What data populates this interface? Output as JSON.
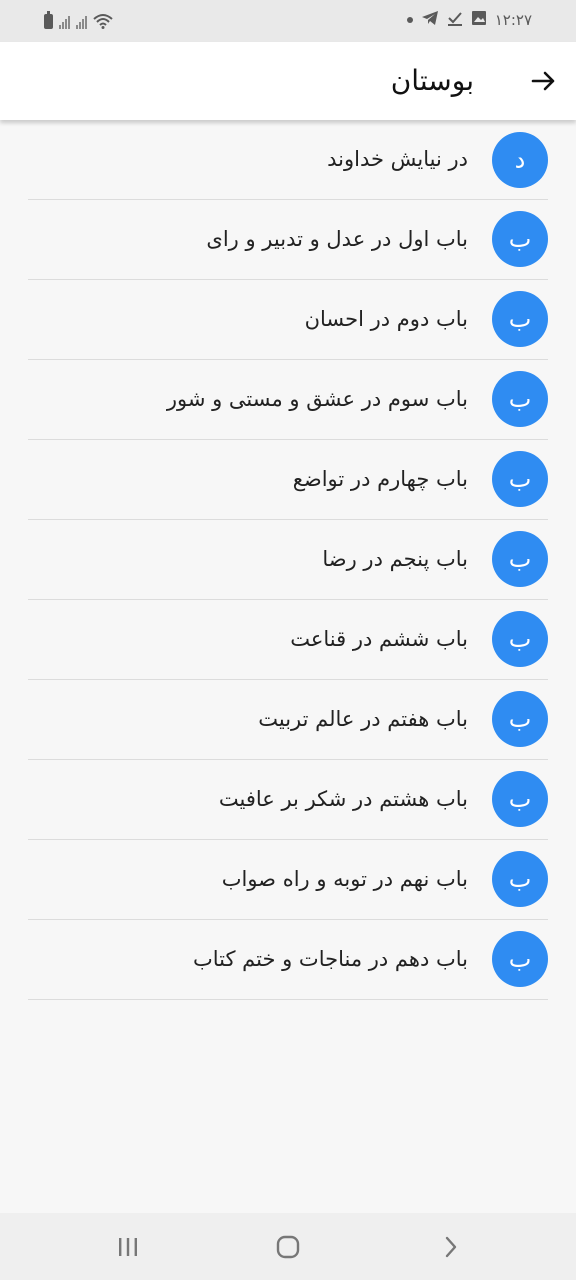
{
  "status_bar": {
    "time": "۱۲:۲۷",
    "icons": [
      "battery-icon",
      "signal-icon",
      "signal-icon",
      "wifi-icon",
      "dot-icon",
      "telegram-icon",
      "check-icon",
      "gallery-icon"
    ]
  },
  "app_bar": {
    "title": "بوستان",
    "back_icon": "arrow-right-icon"
  },
  "list": {
    "items": [
      {
        "avatar": "د",
        "label": "در نیایش خداوند"
      },
      {
        "avatar": "ب",
        "label": "باب اول در عدل و تدبیر و رای"
      },
      {
        "avatar": "ب",
        "label": "باب دوم در احسان"
      },
      {
        "avatar": "ب",
        "label": "باب سوم در عشق و مستی و شور"
      },
      {
        "avatar": "ب",
        "label": "باب چهارم در تواضع"
      },
      {
        "avatar": "ب",
        "label": "باب پنجم در رضا"
      },
      {
        "avatar": "ب",
        "label": "باب ششم در قناعت"
      },
      {
        "avatar": "ب",
        "label": "باب هفتم در عالم تربیت"
      },
      {
        "avatar": "ب",
        "label": "باب هشتم در شکر بر عافیت"
      },
      {
        "avatar": "ب",
        "label": "باب نهم در توبه و راه صواب"
      },
      {
        "avatar": "ب",
        "label": "باب دهم در مناجات و ختم کتاب"
      }
    ]
  },
  "nav_bar": {
    "buttons": [
      "recents-icon",
      "home-icon",
      "back-icon"
    ]
  },
  "colors": {
    "avatar_bg": "#2f8cf2",
    "app_bar_bg": "#ffffff",
    "page_bg": "#f7f7f7"
  }
}
